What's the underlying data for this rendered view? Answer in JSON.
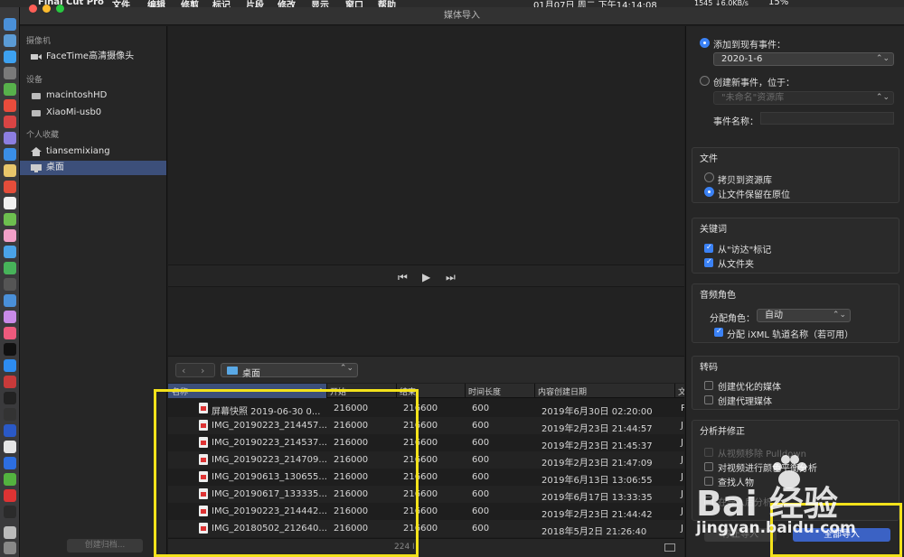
{
  "menubar": {
    "app_name": "Final Cut Pro",
    "menus": [
      "文件",
      "编辑",
      "修剪",
      "标记",
      "片段",
      "修改",
      "显示",
      "窗口",
      "帮助"
    ],
    "clock": "01月07日 周二 下午14:14:08",
    "net": "1545 ↓6.0KB/s",
    "battery": "15%"
  },
  "window": {
    "title": "媒体导入"
  },
  "sidebar": {
    "cameras_header": "摄像机",
    "cameras": [
      {
        "label": "FaceTime高清摄像头",
        "icon": "camera-icon"
      }
    ],
    "devices_header": "设备",
    "devices": [
      {
        "label": "macintoshHD",
        "icon": "disk-icon"
      },
      {
        "label": "XiaoMi-usb0",
        "icon": "disk-icon"
      }
    ],
    "favorites_header": "个人收藏",
    "favorites": [
      {
        "label": "tiansemixiang",
        "icon": "home-icon"
      },
      {
        "label": "桌面",
        "icon": "desktop-icon",
        "selected": true
      }
    ],
    "bottom_button": "创建归档..."
  },
  "browser": {
    "path": "桌面",
    "columns": [
      "名称",
      "开始",
      "结束",
      "时间长度",
      "内容创建日期",
      "文"
    ],
    "rows": [
      {
        "name": "屏幕快照 2019-06-30 0...",
        "start": "216000",
        "end": "216600",
        "duration": "600",
        "created": "2019年6月30日 02:20:00",
        "extra": "P"
      },
      {
        "name": "IMG_20190223_214457...",
        "start": "216000",
        "end": "216600",
        "duration": "600",
        "created": "2019年2月23日 21:44:57",
        "extra": "J"
      },
      {
        "name": "IMG_20190223_214537...",
        "start": "216000",
        "end": "216600",
        "duration": "600",
        "created": "2019年2月23日 21:45:37",
        "extra": "J"
      },
      {
        "name": "IMG_20190223_214709...",
        "start": "216000",
        "end": "216600",
        "duration": "600",
        "created": "2019年2月23日 21:47:09",
        "extra": "J"
      },
      {
        "name": "IMG_20190613_130655...",
        "start": "216000",
        "end": "216600",
        "duration": "600",
        "created": "2019年6月13日 13:06:55",
        "extra": "J"
      },
      {
        "name": "IMG_20190617_133335...",
        "start": "216000",
        "end": "216600",
        "duration": "600",
        "created": "2019年6月17日 13:33:35",
        "extra": "J"
      },
      {
        "name": "IMG_20190223_214442...",
        "start": "216000",
        "end": "216600",
        "duration": "600",
        "created": "2019年2月23日 21:44:42",
        "extra": "J"
      },
      {
        "name": "IMG_20180502_212640...",
        "start": "216000",
        "end": "216600",
        "duration": "600",
        "created": "2018年5月2日 21:26:40",
        "extra": "J"
      }
    ],
    "item_count": "224 I"
  },
  "import_options": {
    "add_existing_event_label": "添加到现有事件：",
    "existing_event_value": "2020-1-6",
    "create_new_event_label": "创建新事件，位于：",
    "new_event_library_placeholder": "\"未命名\"资源库",
    "event_name_label": "事件名称：",
    "files": {
      "title": "文件",
      "copy_label": "拷贝到资源库",
      "leave_label": "让文件保留在原位"
    },
    "keywords": {
      "title": "关键词",
      "finder_tags_label": "从\"访达\"标记",
      "folders_label": "从文件夹"
    },
    "audio_roles": {
      "title": "音频角色",
      "assign_label": "分配角色：",
      "assign_value": "自动",
      "ixml_label": "分配 iXML 轨道名称（若可用）"
    },
    "transcode": {
      "title": "转码",
      "optimized_label": "创建优化的媒体",
      "proxy_label": "创建代理媒体"
    },
    "analyze": {
      "title": "分析并修正",
      "pulldown_label": "从视频移除 Pulldown",
      "balance_label": "对视频进行颜色平衡分析",
      "find_people_label": "查找人物",
      "after_import_label": "在导入后分析"
    },
    "stop_button": "停止导入",
    "import_all_button": "全部导入"
  },
  "watermark": {
    "logo_text": "Bai   经验",
    "url": "jingyan.baidu.com"
  },
  "colors": {
    "accent": "#3b82f6",
    "selection": "#3c4f7a",
    "highlight_box": "#f3e21b"
  }
}
